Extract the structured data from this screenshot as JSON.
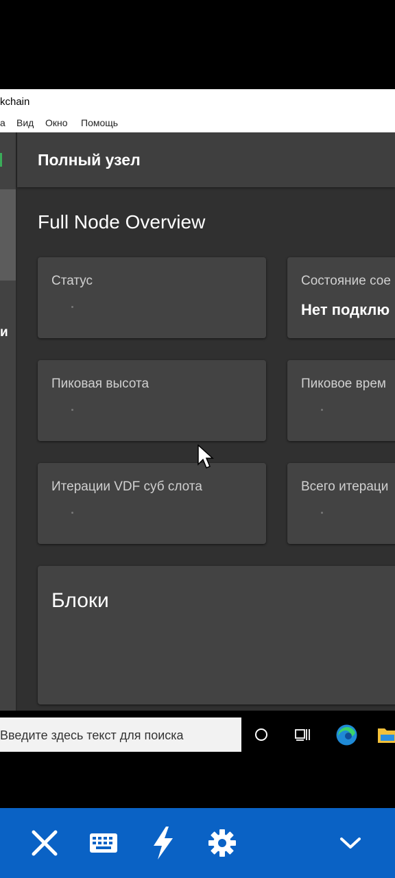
{
  "window": {
    "title": "kchain",
    "menu": [
      "а",
      "Вид",
      "Окно",
      "Помощь"
    ]
  },
  "sidebar": {
    "partial_label": "и"
  },
  "header": {
    "title": "Полный узел"
  },
  "overview": {
    "title": "Full Node Overview",
    "cards": [
      {
        "label": "Статус",
        "value": ""
      },
      {
        "label": "Состояние сое",
        "value": "Нет подклю"
      },
      {
        "label": "Пиковая высота",
        "value": ""
      },
      {
        "label": "Пиковое врем",
        "value": ""
      },
      {
        "label": "Итерации VDF суб слота",
        "value": ""
      },
      {
        "label": "Всего итераци",
        "value": ""
      }
    ],
    "blocks_title": "Блоки"
  },
  "taskbar": {
    "search_placeholder": "Введите здесь текст для поиска",
    "icons": [
      "cortana-icon",
      "task-view-icon",
      "edge-icon",
      "file-explorer-icon"
    ]
  },
  "controls": {
    "icons": [
      "close-icon",
      "keyboard-icon",
      "lightning-icon",
      "settings-icon",
      "chevron-down-icon"
    ]
  },
  "colors": {
    "app_bg": "#303030",
    "card_bg": "#434343",
    "control_bar": "#0a62c5",
    "accent_green": "#3aac59"
  }
}
